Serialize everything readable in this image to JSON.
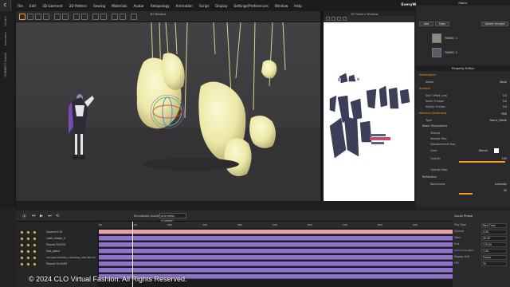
{
  "app": {
    "logo": "C",
    "brand": "EveryWear (Beta)",
    "menu": [
      "File",
      "Edit",
      "3D Garment",
      "2D Pattern",
      "Sewing",
      "Materials",
      "Avatar",
      "Retopology",
      "Animation",
      "Script",
      "Display",
      "Settings/Preferences",
      "Window",
      "Help"
    ],
    "window_controls": [
      "—",
      "□",
      "✕"
    ]
  },
  "left_tabs": [
    "Library",
    "Inventory",
    "CONNECT Assets"
  ],
  "view3d": {
    "title": "3D Window"
  },
  "view2d": {
    "title": "2D Pattern Window"
  },
  "fabric_panel": {
    "title": "Fabric",
    "buttons": [
      "Add",
      "Copy",
      "Delete Unused"
    ],
    "items": [
      {
        "label": "FABRIC 1",
        "color": "#8d8a80"
      },
      {
        "label": "FABRIC 2",
        "color": "#5a5a62"
      }
    ]
  },
  "property_editor": {
    "title": "Property Editor",
    "sections": {
      "information": "Information",
      "surface": "Surface",
      "material": "Material (Selected)",
      "basic": "Basic Parameters",
      "reflection": "Reflection"
    },
    "rows": {
      "name": {
        "k": "Name",
        "v": "Mesh"
      },
      "skin_offset": {
        "k": "Skin Offset (cm)",
        "v": "3.0"
      },
      "static_friction": {
        "k": "Static Friction",
        "v": "3.0"
      },
      "kinetic_friction": {
        "k": "Kinetic Friction",
        "v": "3.0"
      },
      "type": {
        "k": "Type",
        "v": "Fabric_Matte"
      },
      "texture": {
        "k": "Texture",
        "v": ""
      },
      "normal_map": {
        "k": "Normal Map",
        "v": ""
      },
      "displacement": {
        "k": "Displacement Map",
        "v": ""
      },
      "color": {
        "k": "Color",
        "v": "(None)"
      },
      "opacity": {
        "k": "Opacity",
        "v": "100"
      },
      "opacity_map": {
        "k": "Opacity Map",
        "v": ""
      },
      "roughness": {
        "k": "Roughness",
        "v": "Intensity"
      },
      "roughness_val": {
        "k": "",
        "v": "30"
      }
    },
    "material_dropdown": "PBR"
  },
  "timeline": {
    "quality_label": "Simulation Quality",
    "quality_value": "Animation (Custom)",
    "tracks": [
      "Garment 10",
      "cloth_shape_2",
      "Pinned ROOTS",
      "Hat_piece",
      "HairnetAndFeather_Cutoutflag_v001.002.00",
      "Pinned GLOVES"
    ],
    "ticks": [
      "90",
      "100",
      "200",
      "300",
      "400",
      "500",
      "600",
      "700",
      "800",
      "900"
    ],
    "bar_color": "#8d73c9",
    "highlight_color": "#e9a0a0"
  },
  "quick_props": {
    "title": "Quick Phase",
    "rows": [
      {
        "k": "Play Type",
        "v": "Real Time"
      },
      {
        "k": "Current",
        "v": "0.00"
      },
      {
        "k": "Start",
        "v": "00.00"
      },
      {
        "k": "End",
        "v": "170.00"
      },
      {
        "k": "Scene Time Warp",
        "v": "1.00"
      },
      {
        "k": "Display Unit",
        "v": "Frame"
      },
      {
        "k": "FPS",
        "v": "30"
      }
    ]
  },
  "copyright": "© 2024 CLO Virtual Fashion. All Rights Reserved."
}
